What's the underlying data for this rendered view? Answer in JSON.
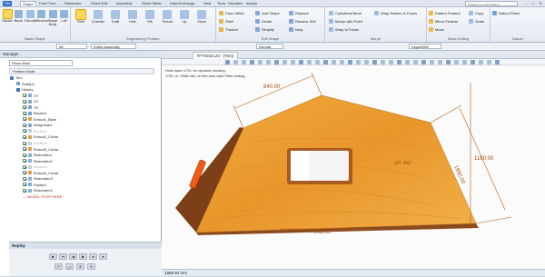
{
  "menubar": {
    "tabs": [
      "File",
      "Shape",
      "Free Form",
      "Wireframe",
      "Direct Edit",
      "Assembly",
      "Sheet Metal",
      "Data Exchange",
      "Heal",
      "Tools",
      "Visualize",
      "Inquire"
    ],
    "active_tab": "Shape",
    "search_placeholder": "Search a command",
    "win_min": "–",
    "win_max": "□",
    "win_close": "✕"
  },
  "ribbon": {
    "basic_shape": {
      "label": "Basic Shape",
      "tools": [
        "Sketch",
        "Block",
        "Extrude",
        "Revolve",
        "Swept Body",
        "Loft"
      ]
    },
    "engineering": {
      "label": "Engineering Feature",
      "tools": [
        "Fillet",
        "Chamfer",
        "Draft",
        "Hole",
        "Rib",
        "Thread",
        "Lip",
        "Stock"
      ]
    },
    "edit_shape": {
      "label": "Edit Shape",
      "col1": [
        "Face Offset",
        "Shell",
        "Thicken"
      ],
      "col2": [
        "Add Shape",
        "Divide",
        "Simplify"
      ],
      "col3": [
        "Replace",
        "Resolve Self",
        "Inlay"
      ]
    },
    "morph": {
      "label": "Morph",
      "col1": [
        "Cylindrical Bend",
        "Morph with Point",
        "Wrap to Faces"
      ],
      "col2": [
        "Wrap Pattern to Faces"
      ]
    },
    "basic_editing": {
      "label": "Basic Editing",
      "col1": [
        "Pattern Feature",
        "Mirror Feature",
        "Move"
      ],
      "col2": [
        "Copy",
        "Scale"
      ]
    },
    "datum": {
      "label": "Datum",
      "col1": [
        "Datum Plane"
      ]
    }
  },
  "filterbar": {
    "filter_value": "All",
    "assembly_value": "Entire Assembly",
    "mode_value": "Normal",
    "layer_value": "Layer0000"
  },
  "manager": {
    "title": "Manager",
    "show_mode": "Show Most",
    "tree_header": "Feature Node",
    "tree": [
      {
        "label": "Teni",
        "level": 0,
        "kind": "part",
        "checked": false,
        "muted": false
      },
      {
        "label": "Solid(1)",
        "level": 1,
        "kind": "solid",
        "checked": false,
        "muted": false
      },
      {
        "label": "History",
        "level": 1,
        "kind": "history",
        "checked": false,
        "muted": false
      },
      {
        "label": "XY",
        "level": 2,
        "kind": "plane",
        "checked": true,
        "muted": false
      },
      {
        "label": "XZ",
        "level": 2,
        "kind": "plane",
        "checked": true,
        "muted": false
      },
      {
        "label": "YZ",
        "level": 2,
        "kind": "plane",
        "checked": true,
        "muted": false
      },
      {
        "label": "Boceto1",
        "level": 2,
        "kind": "sketch",
        "checked": true,
        "muted": false
      },
      {
        "label": "Extrud1_Base",
        "level": 2,
        "kind": "extrude",
        "checked": true,
        "muted": false
      },
      {
        "label": "Desgrosar1",
        "level": 2,
        "kind": "feature",
        "checked": true,
        "muted": false
      },
      {
        "label": "Boceto2",
        "level": 2,
        "kind": "sketch",
        "checked": true,
        "muted": true
      },
      {
        "label": "Extrud2_Cortar",
        "level": 2,
        "kind": "extrude",
        "checked": true,
        "muted": false
      },
      {
        "label": "Boceto3",
        "level": 2,
        "kind": "sketch",
        "checked": true,
        "muted": true
      },
      {
        "label": "Extrud3_Cortar",
        "level": 2,
        "kind": "extrude",
        "checked": true,
        "muted": false
      },
      {
        "label": "Redondeo1",
        "level": 2,
        "kind": "fillet",
        "checked": true,
        "muted": false
      },
      {
        "label": "Redondeo2",
        "level": 2,
        "kind": "fillet",
        "checked": true,
        "muted": false
      },
      {
        "label": "Boceto4",
        "level": 2,
        "kind": "sketch",
        "checked": true,
        "muted": true
      },
      {
        "label": "Extrud4_Cortar",
        "level": 2,
        "kind": "extrude",
        "checked": true,
        "muted": false
      },
      {
        "label": "Redondeo3",
        "level": 2,
        "kind": "fillet",
        "checked": true,
        "muted": false
      },
      {
        "label": "Espejo1",
        "level": 2,
        "kind": "mirror",
        "checked": true,
        "muted": false
      },
      {
        "label": "Redondeo4",
        "level": 2,
        "kind": "fillet",
        "checked": true,
        "muted": false
      },
      {
        "label": "MODEL STOP HERE",
        "level": 2,
        "kind": "stop",
        "checked": false,
        "muted": false
      }
    ]
  },
  "replay": {
    "title": "Replay"
  },
  "viewport": {
    "tab_label": "RTT2022,Z3 - [Teni]",
    "hint1": "Hold down <F2> for dynamic viewing.",
    "hint2": "<F8> or <Shift-roll> to find next valid Filter setting.",
    "dim_top": "840.00",
    "dim_right_slant": "1950.00",
    "dim_height": "1180.00",
    "dim_bottom": "2480.00",
    "dim_angle": "(47.46)°",
    "status": "1865.94 mm"
  },
  "colors": {
    "wood": "#e99a2e",
    "wood_dark": "#7d3f18",
    "accent": "#2e6fc7",
    "dim": "#b85d12"
  }
}
